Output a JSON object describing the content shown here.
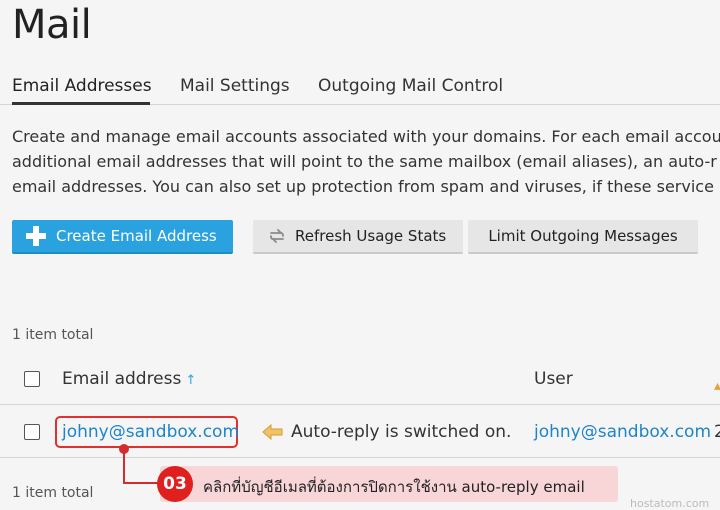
{
  "page": {
    "title": "Mail"
  },
  "tabs": [
    {
      "label": "Email Addresses",
      "active": true
    },
    {
      "label": "Mail Settings",
      "active": false
    },
    {
      "label": "Outgoing Mail Control",
      "active": false
    }
  ],
  "description": [
    "Create and manage email accounts associated with your domains. For each email accou",
    "additional email addresses that will point to the same mailbox (email aliases), an auto-r",
    "email addresses. You can also set up protection from spam and viruses, if these service"
  ],
  "toolbar": {
    "create_label": "Create Email Address",
    "refresh_label": "Refresh Usage Stats",
    "limit_label": "Limit Outgoing Messages"
  },
  "list": {
    "total_top": "1 item total",
    "total_bottom": "1 item total",
    "columns": {
      "email": "Email address",
      "sort_indicator": "↑",
      "user": "User"
    },
    "rows": [
      {
        "email": "johny@sandbox.com",
        "status": "Auto-reply is switched on.",
        "user": "johny@sandbox.com",
        "truncated": "2"
      }
    ]
  },
  "annotation": {
    "step": "03",
    "text": "คลิกที่บัญชีอีเมลที่ต้องการปิดการใช้งาน auto-reply email"
  },
  "watermark": "hostatom.com",
  "colors": {
    "accent": "#2aa2e0",
    "link": "#1e84c9",
    "annotation": "#e0201f",
    "callout_bg": "#f8d6d8"
  },
  "icons": {
    "create": "plus-icon",
    "refresh": "refresh-icon",
    "autoreply": "left-arrow-icon"
  }
}
